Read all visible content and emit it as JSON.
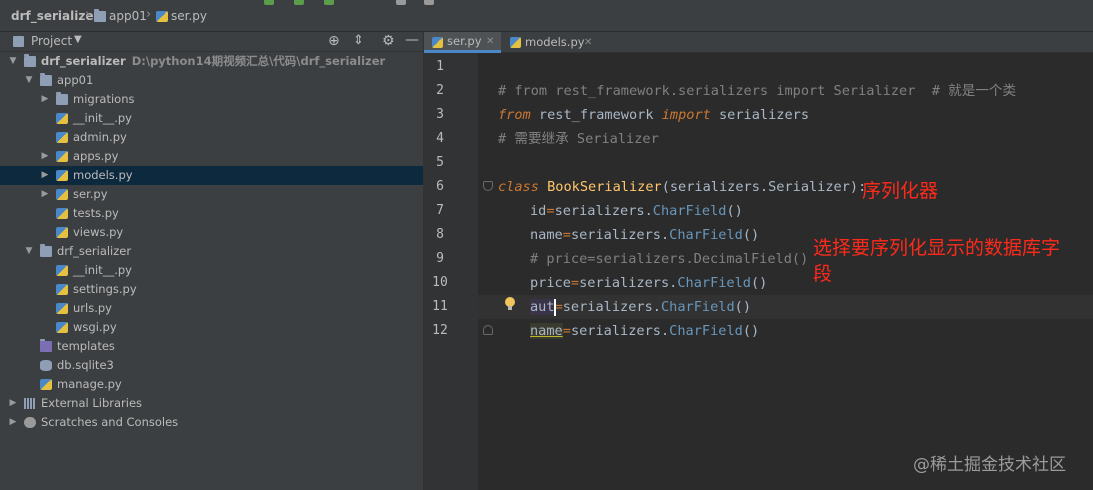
{
  "breadcrumb": {
    "project": "drf_serializer",
    "folder": "app01",
    "file": "ser.py"
  },
  "project_panel": {
    "title": "Project",
    "tree": [
      {
        "label": "drf_serializer",
        "path": "D:\\python14期视频汇总\\代码\\drf_serializer",
        "icon": "folder-icon",
        "expanded": true
      },
      {
        "label": "app01",
        "icon": "folder-icon",
        "expanded": true
      },
      {
        "label": "migrations",
        "icon": "folder-icon",
        "expanded": false
      },
      {
        "label": "__init__.py",
        "icon": "python-file-icon"
      },
      {
        "label": "admin.py",
        "icon": "python-file-icon"
      },
      {
        "label": "apps.py",
        "icon": "python-file-icon",
        "expanded": false
      },
      {
        "label": "models.py",
        "icon": "python-file-icon",
        "expanded": false,
        "selected": true
      },
      {
        "label": "ser.py",
        "icon": "python-file-icon",
        "expanded": false
      },
      {
        "label": "tests.py",
        "icon": "python-file-icon"
      },
      {
        "label": "views.py",
        "icon": "python-file-icon"
      },
      {
        "label": "drf_serializer",
        "icon": "folder-icon",
        "expanded": true
      },
      {
        "label": "__init__.py",
        "icon": "python-file-icon"
      },
      {
        "label": "settings.py",
        "icon": "python-file-icon"
      },
      {
        "label": "urls.py",
        "icon": "python-file-icon"
      },
      {
        "label": "wsgi.py",
        "icon": "python-file-icon"
      },
      {
        "label": "templates",
        "icon": "folder-icon"
      },
      {
        "label": "db.sqlite3",
        "icon": "database-icon"
      },
      {
        "label": "manage.py",
        "icon": "python-file-icon"
      },
      {
        "label": "External Libraries",
        "icon": "library-icon",
        "expanded": false
      },
      {
        "label": "Scratches and Consoles",
        "icon": "scratch-icon",
        "expanded": false
      }
    ]
  },
  "tabs": [
    {
      "label": "ser.py",
      "active": true
    },
    {
      "label": "models.py",
      "active": false
    }
  ],
  "editor": {
    "line_numbers": [
      "1",
      "2",
      "3",
      "4",
      "5",
      "6",
      "7",
      "8",
      "9",
      "10",
      "11",
      "12"
    ],
    "lines": {
      "l2": "# from rest_framework.serializers import Serializer  # 就是一个类",
      "l3_kw_from": "from",
      "l3_mod": " rest_framework ",
      "l3_kw_import": "import",
      "l3_name": " serializers",
      "l4": "# 需要继承 Serializer",
      "l6_kw": "class",
      "l6_cls": " BookSerializer",
      "l6_rest": "(serializers.Serializer):",
      "l7_a": "id",
      "l7_eq": "=",
      "l7_b": "serializers.",
      "l7_fn": "CharField",
      "l7_c": "()",
      "l8_a": "name",
      "l8_eq": "=",
      "l8_b": "serializers.",
      "l8_fn": "CharField",
      "l8_c": "()",
      "l9": "# price=serializers.DecimalField()",
      "l10_a": "price",
      "l10_eq": "=",
      "l10_b": "serializers.",
      "l10_fn": "CharField",
      "l10_c": "()",
      "l11_a": "aut",
      "l11_eq": "=",
      "l11_b": "serializers.",
      "l11_fn": "CharField",
      "l11_c": "()",
      "l12_a": "name",
      "l12_eq": "=",
      "l12_b": "serializers.",
      "l12_fn": "CharField",
      "l12_c": "()"
    }
  },
  "annotations": {
    "serializer_note": "序列化器",
    "fields_note_line1": "选择要序列化显示的数据库字",
    "fields_note_line2": "段"
  },
  "watermark": "@稀土掘金技术社区"
}
